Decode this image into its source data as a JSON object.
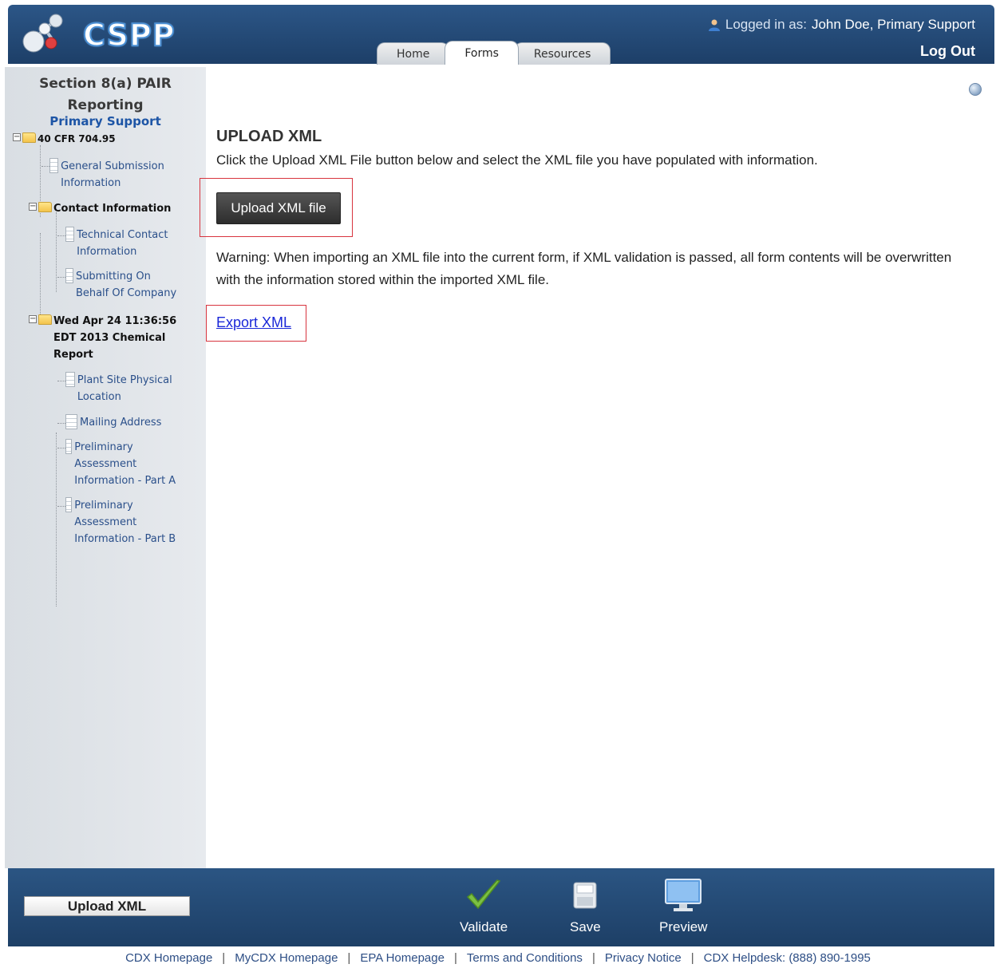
{
  "header": {
    "app_name": "CSPP",
    "logged_in_label": "Logged in as:",
    "user_name": "John Doe, Primary Support",
    "logout_label": "Log Out",
    "tabs": [
      {
        "label": "Home",
        "active": false
      },
      {
        "label": "Forms",
        "active": true
      },
      {
        "label": "Resources",
        "active": false
      }
    ]
  },
  "sidebar": {
    "title": "Section 8(a) PAIR Reporting",
    "role": "Primary Support",
    "tree": {
      "root": "40 CFR 704.95",
      "general_submission": "General Submission Information",
      "contact_folder": "Contact Information",
      "technical_contact": "Technical Contact Information",
      "submitting_on_behalf": "Submitting On Behalf Of Company",
      "report_folder": "Wed Apr 24 11:36:56 EDT 2013 Chemical Report",
      "plant_site": "Plant Site Physical Location",
      "mailing_address": "Mailing Address",
      "prelim_a": "Preliminary Assessment Information - Part A",
      "prelim_b": "Preliminary Assessment Information - Part B"
    }
  },
  "main": {
    "title": "UPLOAD XML",
    "instructions": "Click the Upload XML File button below and select the XML file you have populated with information.",
    "upload_button": "Upload XML file",
    "warning": "Warning: When importing an XML file into the current form, if XML validation is passed, all form contents will be overwritten with the information stored within the imported XML file.",
    "export_link": "Export XML"
  },
  "footer": {
    "upload_xml": "Upload XML",
    "actions": {
      "validate": "Validate",
      "save": "Save",
      "preview": "Preview"
    },
    "links": {
      "cdx_home": "CDX Homepage",
      "mycdx_home": "MyCDX Homepage",
      "epa_home": "EPA Homepage",
      "terms": "Terms and Conditions",
      "privacy": "Privacy Notice",
      "helpdesk": "CDX Helpdesk: (888) 890-1995"
    }
  }
}
